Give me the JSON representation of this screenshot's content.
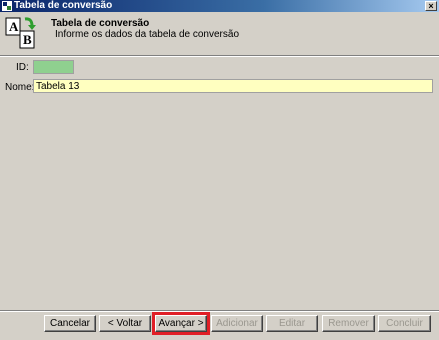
{
  "window": {
    "title": "Tabela de conversão",
    "close_glyph": "×"
  },
  "header": {
    "title": "Tabela de conversão",
    "subtitle": "Informe os dados da tabela de conversão",
    "icon_letters": [
      "A",
      "B"
    ]
  },
  "form": {
    "id_label": "ID:",
    "id_value": "",
    "name_label": "Nome:",
    "name_value": "Tabela 13"
  },
  "buttons": {
    "cancel": "Cancelar",
    "back": "< Voltar",
    "next": "Avançar >",
    "add": "Adicionar",
    "edit": "Editar",
    "remove": "Remover",
    "finish": "Concluir"
  },
  "colors": {
    "titlebar_start": "#0a246a",
    "id_field": "#8fd08f",
    "name_field": "#ffffc0",
    "highlight": "#e01f26"
  }
}
